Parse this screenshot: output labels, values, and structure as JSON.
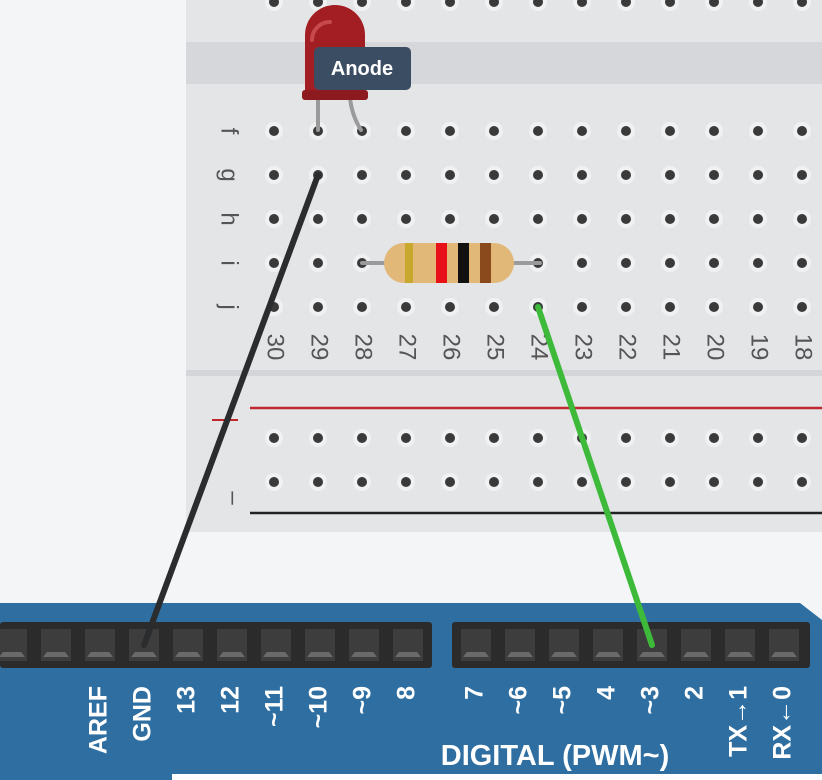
{
  "tooltip": {
    "label": "Anode"
  },
  "breadboard": {
    "row_letters": [
      "f",
      "g",
      "h",
      "i",
      "j"
    ],
    "column_numbers": [
      "30",
      "29",
      "28",
      "27",
      "26",
      "25",
      "24",
      "23",
      "22",
      "21",
      "20",
      "19",
      "18"
    ],
    "rail_labels": {
      "negative": "–"
    }
  },
  "arduino": {
    "left_pins": [
      "AREF",
      "GND",
      "13",
      "12",
      "~11",
      "~10",
      "~9",
      "8"
    ],
    "right_pins": [
      "7",
      "~6",
      "~5",
      "4",
      "~3",
      "2",
      "TX→1",
      "RX←0"
    ],
    "digital_label": "DIGITAL (PWM~)"
  },
  "colors": {
    "board_blue": "#2e6ea1",
    "breadboard": "#e4e5e7",
    "led_red": "#a31e22",
    "wire_ground": "#2a2c2e",
    "wire_signal": "#3dba3a",
    "rail_positive": "#c0282d",
    "rail_negative": "#222222",
    "tooltip_bg": "#3b4d63"
  },
  "resistor_bands": [
    "#c9a82e",
    "#e8111a",
    "#111111",
    "#8a4a1c"
  ]
}
